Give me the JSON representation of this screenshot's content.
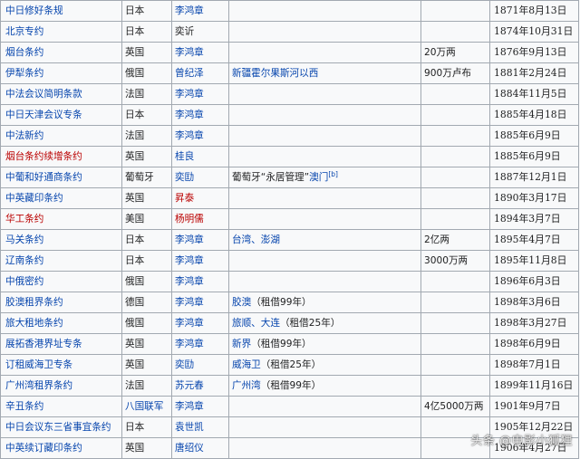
{
  "rows": [
    {
      "treaty": "中日修好条规",
      "country": "日本",
      "signer": "李鸿章",
      "territory": "",
      "indemnity": "",
      "date": "1871年8月13日"
    },
    {
      "treaty": "北京专约",
      "country": "日本",
      "signer": "奕䜣",
      "territory": "",
      "indemnity": "",
      "date": "1874年10月31日"
    },
    {
      "treaty": "烟台条约",
      "country": "英国",
      "signer": "李鸿章",
      "territory": "",
      "indemnity": "20万两",
      "date": "1876年9月13日"
    },
    {
      "treaty": "伊犁条约",
      "country": "俄国",
      "signer": "曾纪泽",
      "territory": "新疆霍尔果斯河以西",
      "indemnity": "900万卢布",
      "date": "1881年2月24日"
    },
    {
      "treaty": "中法会议简明条款",
      "country": "法国",
      "signer": "李鸿章",
      "territory": "",
      "indemnity": "",
      "date": "1884年11月5日"
    },
    {
      "treaty": "中日天津会议专条",
      "country": "日本",
      "signer": "李鸿章",
      "territory": "",
      "indemnity": "",
      "date": "1885年4月18日"
    },
    {
      "treaty": "中法新约",
      "country": "法国",
      "signer": "李鸿章",
      "territory": "",
      "indemnity": "",
      "date": "1885年6月9日"
    },
    {
      "treaty": "烟台条约续增条约",
      "country": "英国",
      "signer": "桂良",
      "territory": "",
      "indemnity": "",
      "date": "1885年6月9日"
    },
    {
      "treaty": "中葡和好通商条约",
      "country": "葡萄牙",
      "signer": "奕劻",
      "territory_pre": "葡萄牙“永居管理”",
      "territory_link": "澳门",
      "territory_note": "[b]",
      "indemnity": "",
      "date": "1887年12月1日"
    },
    {
      "treaty": "中英藏印条约",
      "country": "英国",
      "signer": "昇泰",
      "territory": "",
      "indemnity": "",
      "date": "1890年3月17日"
    },
    {
      "treaty": "华工条约",
      "country": "美国",
      "signer": "杨明儒",
      "territory": "",
      "indemnity": "",
      "date": "1894年3月7日"
    },
    {
      "treaty": "马关条约",
      "country": "日本",
      "signer": "李鸿章",
      "territory": "台湾、澎湖",
      "indemnity": "2亿两",
      "date": "1895年4月7日"
    },
    {
      "treaty": "辽南条约",
      "country": "日本",
      "signer": "李鸿章",
      "territory": "",
      "indemnity": "3000万两",
      "date": "1895年11月8日"
    },
    {
      "treaty": "中俄密约",
      "country": "俄国",
      "signer": "李鸿章",
      "territory": "",
      "indemnity": "",
      "date": "1896年6月3日"
    },
    {
      "treaty": "胶澳租界条约",
      "country": "德国",
      "signer": "李鸿章",
      "territory_link": "胶澳",
      "territory_note": "（租借99年）",
      "indemnity": "",
      "date": "1898年3月6日"
    },
    {
      "treaty": "旅大租地条约",
      "country": "俄国",
      "signer": "李鸿章",
      "territory_link": "旅顺、大连",
      "territory_note": "（租借25年）",
      "indemnity": "",
      "date": "1898年3月27日"
    },
    {
      "treaty": "展拓香港界址专条",
      "country": "英国",
      "signer": "李鸿章",
      "territory_link": "新界",
      "territory_note": "（租借99年）",
      "indemnity": "",
      "date": "1898年6月9日"
    },
    {
      "treaty": "订租威海卫专条",
      "country": "英国",
      "signer": "奕劻",
      "territory_link": "威海卫",
      "territory_note": "（租借25年）",
      "indemnity": "",
      "date": "1898年7月1日"
    },
    {
      "treaty": "广州湾租界条约",
      "country": "法国",
      "signer": "苏元春",
      "territory_link": "广州湾",
      "territory_note": "（租借99年）",
      "indemnity": "",
      "date": "1899年11月16日"
    },
    {
      "treaty": "辛丑条约",
      "country": "八国联军",
      "signer": "李鸿章",
      "territory": "",
      "indemnity": "4亿5000万两",
      "date": "1901年9月7日"
    },
    {
      "treaty": "中日会议东三省事宜条约",
      "country": "日本",
      "signer": "袁世凯",
      "territory": "",
      "indemnity": "",
      "date": "1905年12月22日"
    },
    {
      "treaty": "中英续订藏印条约",
      "country": "英国",
      "signer": "唐绍仪",
      "territory": "",
      "indemnity": "",
      "date": "1906年4月27日"
    }
  ],
  "styles": {
    "country_link_rows": [
      19
    ],
    "red_treaty_rows": [
      7,
      10
    ],
    "red_signer_rows": [
      9,
      10
    ],
    "plain_signer_rows": [
      1
    ]
  },
  "colors": {
    "link": "#0645ad",
    "red_link": "#ba0000",
    "border": "#a2a9b1",
    "background": "#f8f9fa"
  },
  "watermark": "头条 @电影小狐狸"
}
